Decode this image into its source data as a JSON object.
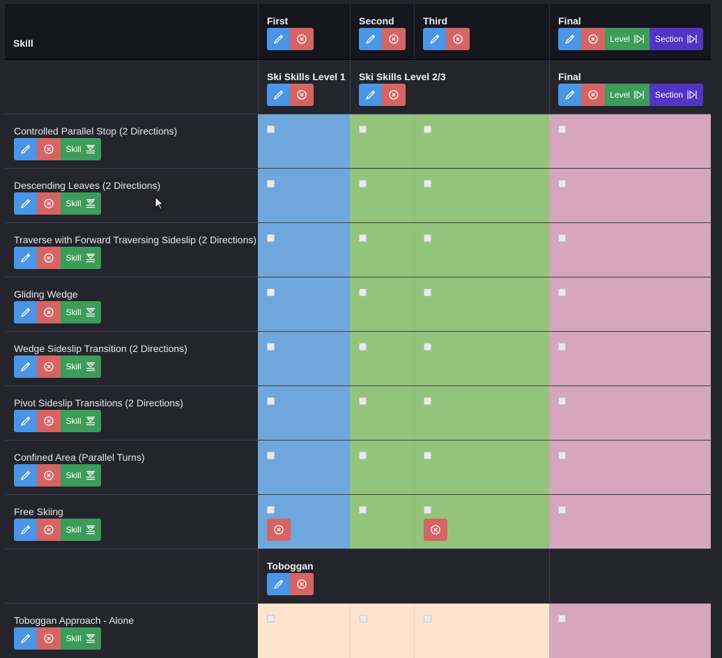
{
  "header": {
    "skill_label": "Skill",
    "columns": [
      {
        "label": "First"
      },
      {
        "label": "Second"
      },
      {
        "label": "Third"
      },
      {
        "label": "Final",
        "level_label": "Level",
        "section_label": "Section"
      }
    ]
  },
  "sections": [
    {
      "groups": [
        {
          "label": "Ski Skills Level 1"
        },
        {
          "label": "Ski Skills Level 2/3"
        },
        {
          "label": "Final",
          "level_label": "Level",
          "section_label": "Section"
        }
      ],
      "skills": [
        {
          "name": "Controlled Parallel Stop (2 Directions)",
          "skill_label": "Skill"
        },
        {
          "name": "Descending Leaves (2 Directions)",
          "skill_label": "Skill"
        },
        {
          "name": "Traverse with Forward Traversing Sideslip (2 Directions)",
          "skill_label": "Skill"
        },
        {
          "name": "Gliding Wedge",
          "skill_label": "Skill"
        },
        {
          "name": "Wedge Sideslip Transition (2 Directions)",
          "skill_label": "Skill"
        },
        {
          "name": "Pivot Sideslip Transitions (2 Directions)",
          "skill_label": "Skill"
        },
        {
          "name": "Confined Area (Parallel Turns)",
          "skill_label": "Skill"
        },
        {
          "name": "Free Skiing",
          "skill_label": "Skill"
        }
      ]
    },
    {
      "groups": [
        {
          "label": "Toboggan"
        }
      ],
      "skills": [
        {
          "name": "Toboggan Approach - Alone",
          "skill_label": "Skill"
        }
      ]
    }
  ],
  "colors": {
    "level1": "#6fa7dc",
    "level23": "#94c47c",
    "final": "#d5a6bd",
    "toboggan": "#fde5cd",
    "edit": "#4a95e6",
    "delete": "#d56464",
    "skill": "#3e9c5b",
    "section": "#5135c4"
  },
  "icons": [
    "pencil-icon",
    "circle-x-icon",
    "collapse-icon",
    "skip-forward-icon"
  ]
}
